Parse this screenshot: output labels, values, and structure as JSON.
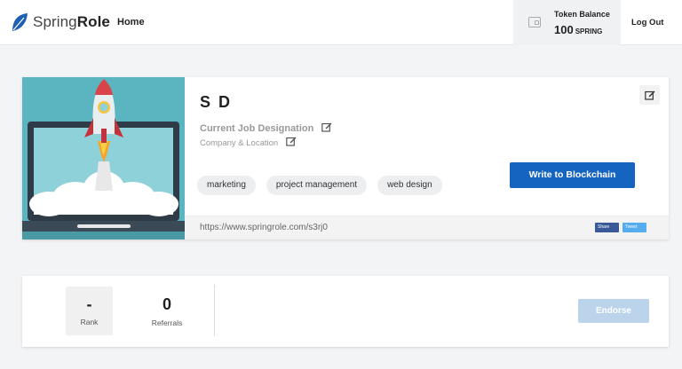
{
  "brand": {
    "name_part1": "Spring",
    "name_part2": "Role"
  },
  "nav": {
    "home": "Home",
    "logout": "Log Out"
  },
  "token": {
    "label": "Token Balance",
    "amount": "100",
    "unit": "SPRING"
  },
  "profile": {
    "name": "S D",
    "job_designation": "Current Job Designation",
    "company_location": "Company & Location",
    "skills": [
      "marketing",
      "project management",
      "web design"
    ],
    "write_button": "Write to Blockchain",
    "profile_url": "https://www.springrole.com/s3rj0",
    "share_label": "Share",
    "tweet_label": "Tweet"
  },
  "stats": {
    "rank_value": "-",
    "rank_label": "Rank",
    "referrals_value": "0",
    "referrals_label": "Referrals",
    "endorse_button": "Endorse"
  },
  "colors": {
    "primary": "#1565c0",
    "endorse_disabled": "#bcd3ec",
    "hero_bg": "#5bb5c1"
  }
}
